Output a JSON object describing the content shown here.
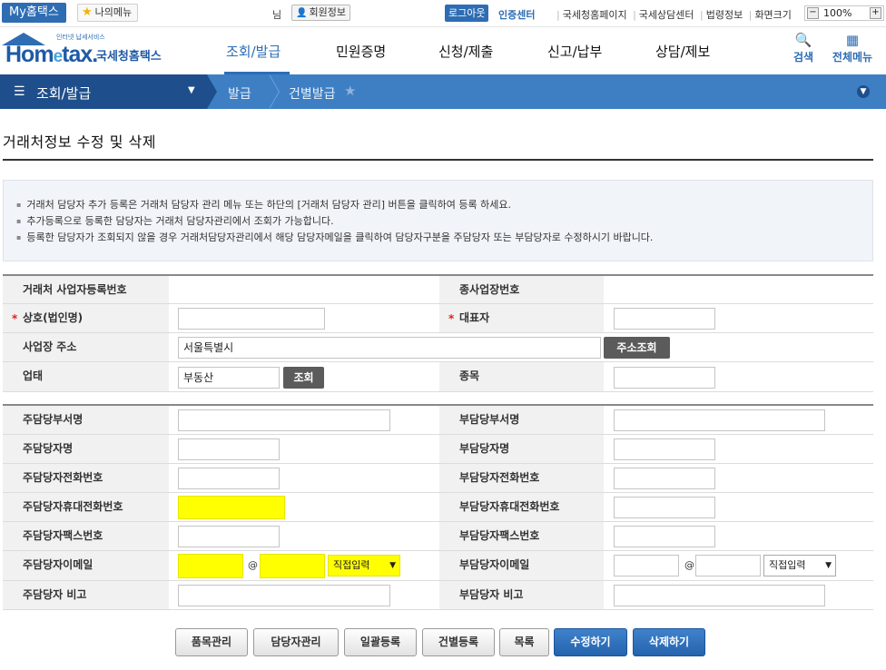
{
  "topbar": {
    "my_hometax": "My홈택스",
    "my_menu": "나의메뉴",
    "user_suffix": "님",
    "member_info": "회원정보",
    "logout": "로그아웃",
    "cert_center": "인증센터",
    "links": [
      "국세청홈페이지",
      "국세상담센터",
      "법령정보",
      "화면크기"
    ],
    "zoom_value": "100%"
  },
  "header": {
    "logo_small": "인터넷 납세서비스",
    "logo_text": "Hometax",
    "logo_kor": "국세청홈택스",
    "nav": [
      "조회/발급",
      "민원증명",
      "신청/제출",
      "신고/납부",
      "상담/제보"
    ],
    "search_label": "검색",
    "allmenu_label": "전체메뉴"
  },
  "location": {
    "main": "조회/발급",
    "crumb1": "발급",
    "crumb2": "건별발급"
  },
  "page": {
    "title": "거래처정보 수정 및 삭제"
  },
  "notice": [
    "거래처 담당자 추가 등록은 거래처 담당자 관리 메뉴 또는 하단의 [거래처 담당자 관리] 버튼을 클릭하여 등록 하세요.",
    "추가등록으로 등록한 담당자는 거래처 담당자관리에서 조회가 가능합니다.",
    "등록한 담당자가 조회되지 않을 경우 거래처담당자관리에서 해당 담당자메일을 클릭하여 담당자구분을 주담당자 또는 부담당자로 수정하시기 바랍니다."
  ],
  "company": {
    "label_bizno": "거래처 사업자등록번호",
    "label_subbiz": "종사업장번호",
    "label_name": "상호(법인명)",
    "label_ceo": "대표자",
    "label_address": "사업장 주소",
    "address_value": "서울특별시",
    "address_btn": "주소조회",
    "label_biztype": "업태",
    "biztype_value": "부동산",
    "biztype_btn": "조회",
    "label_bizitem": "종목"
  },
  "contacts": {
    "main_dept": "주담당부서명",
    "sub_dept": "부담당부서명",
    "main_name": "주담당자명",
    "sub_name": "부담당자명",
    "main_tel": "주담당자전화번호",
    "sub_tel": "부담당자전화번호",
    "main_mobile": "주담당자휴대전화번호",
    "sub_mobile": "부담당자휴대전화번호",
    "main_fax": "주담당자팩스번호",
    "sub_fax": "부담당자팩스번호",
    "main_email": "주담당자이메일",
    "sub_email": "부담당자이메일",
    "main_note": "주담당자 비고",
    "sub_note": "부담당자 비고",
    "email_at": "@",
    "domain_select": "직접입력"
  },
  "buttons": [
    "품목관리",
    "담당자관리",
    "일괄등록",
    "건별등록",
    "목록",
    "수정하기",
    "삭제하기"
  ],
  "colors": {
    "primary": "#2e6db4",
    "nav_dark": "#1e4f8c",
    "nav_light": "#3e7fc4",
    "highlight": "#ffff00"
  }
}
